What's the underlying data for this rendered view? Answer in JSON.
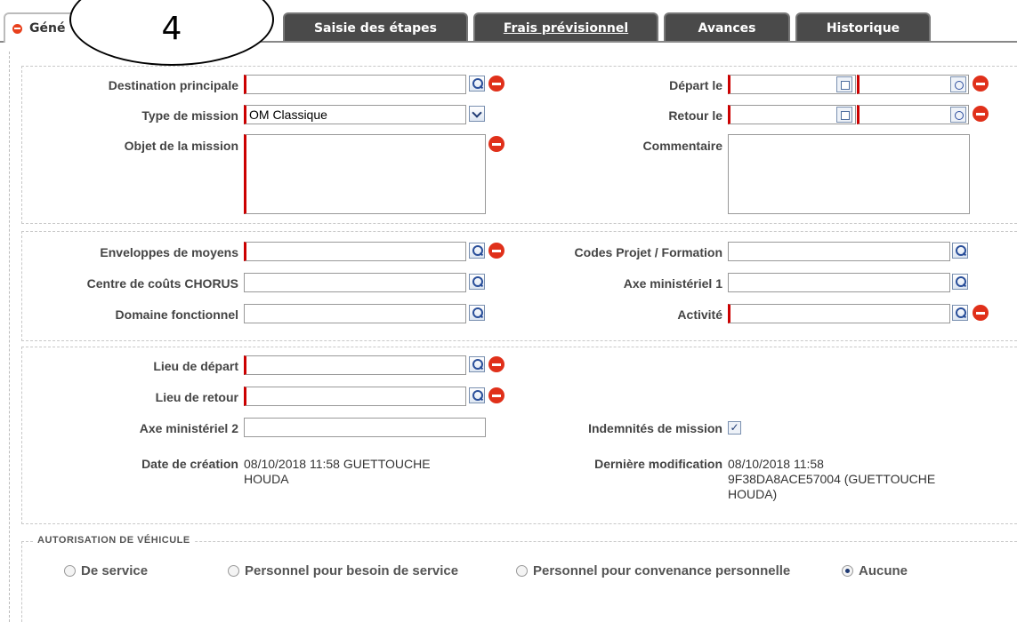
{
  "tabs": [
    {
      "label": "Géné"
    },
    {
      "label": "Saisie des étapes"
    },
    {
      "label": "Frais prévisionnel"
    },
    {
      "label": "Avances"
    },
    {
      "label": "Historique"
    }
  ],
  "annotation_number": "4",
  "general": {
    "destination_label": "Destination principale",
    "type_label": "Type de mission",
    "type_value": "OM Classique",
    "objet_label": "Objet de la mission",
    "depart_label": "Départ le",
    "retour_label": "Retour le",
    "commentaire_label": "Commentaire"
  },
  "budget": {
    "enveloppes_label": "Enveloppes de moyens",
    "centre_label": "Centre de coûts CHORUS",
    "domaine_label": "Domaine fonctionnel",
    "codes_label": "Codes Projet / Formation",
    "axe1_label": "Axe ministériel 1",
    "activite_label": "Activité"
  },
  "lieux": {
    "depart_label": "Lieu de départ",
    "retour_label": "Lieu de retour",
    "axe2_label": "Axe ministériel 2",
    "indemnites_label": "Indemnités de mission",
    "indemnites_checked": true,
    "creation_label": "Date de création",
    "creation_line1": "08/10/2018 11:58 GUETTOUCHE",
    "creation_line2": "HOUDA",
    "modif_label": "Dernière modification",
    "modif_line1": "08/10/2018 11:58",
    "modif_line2": "9F38DA8ACE57004 (GUETTOUCHE",
    "modif_line3": "HOUDA)"
  },
  "vehicule": {
    "title": "AUTORISATION DE VÉHICULE",
    "options": [
      {
        "label": "De service",
        "selected": false
      },
      {
        "label": "Personnel pour besoin de service",
        "selected": false
      },
      {
        "label": "Personnel pour convenance personnelle",
        "selected": false
      },
      {
        "label": "Aucune",
        "selected": true
      }
    ]
  }
}
